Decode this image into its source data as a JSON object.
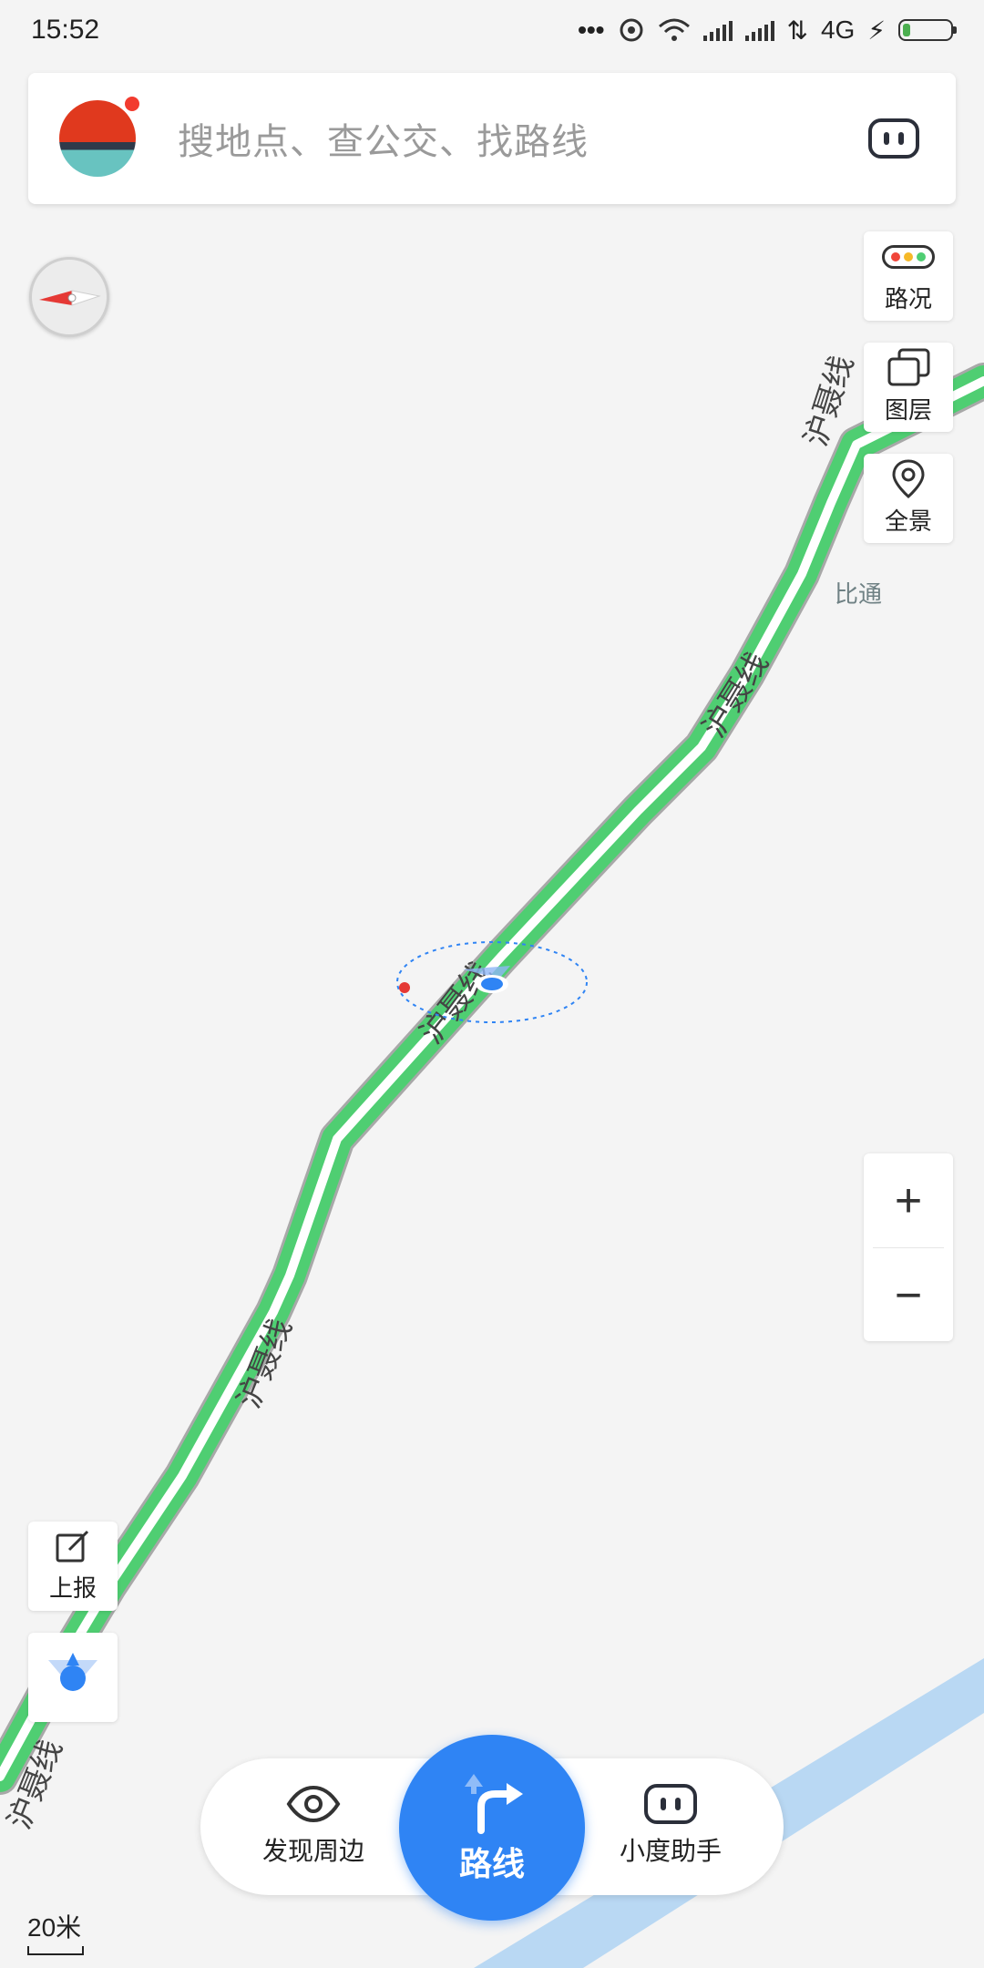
{
  "status_bar": {
    "time": "15:52",
    "network": "4G"
  },
  "search": {
    "placeholder": "搜地点、查公交、找路线"
  },
  "tools": {
    "traffic": "路况",
    "layers": "图层",
    "panorama": "全景",
    "zoom_in": "+",
    "zoom_out": "−",
    "report": "上报"
  },
  "map": {
    "road_name": "沪聂线",
    "place_label": "比通",
    "scale": "20米"
  },
  "bottom": {
    "discover": "发现周边",
    "route": "路线",
    "assistant": "小度助手"
  },
  "colors": {
    "route_green": "#4fce72",
    "accent_blue": "#2f84f4",
    "river_blue": "#b9d8f3"
  }
}
